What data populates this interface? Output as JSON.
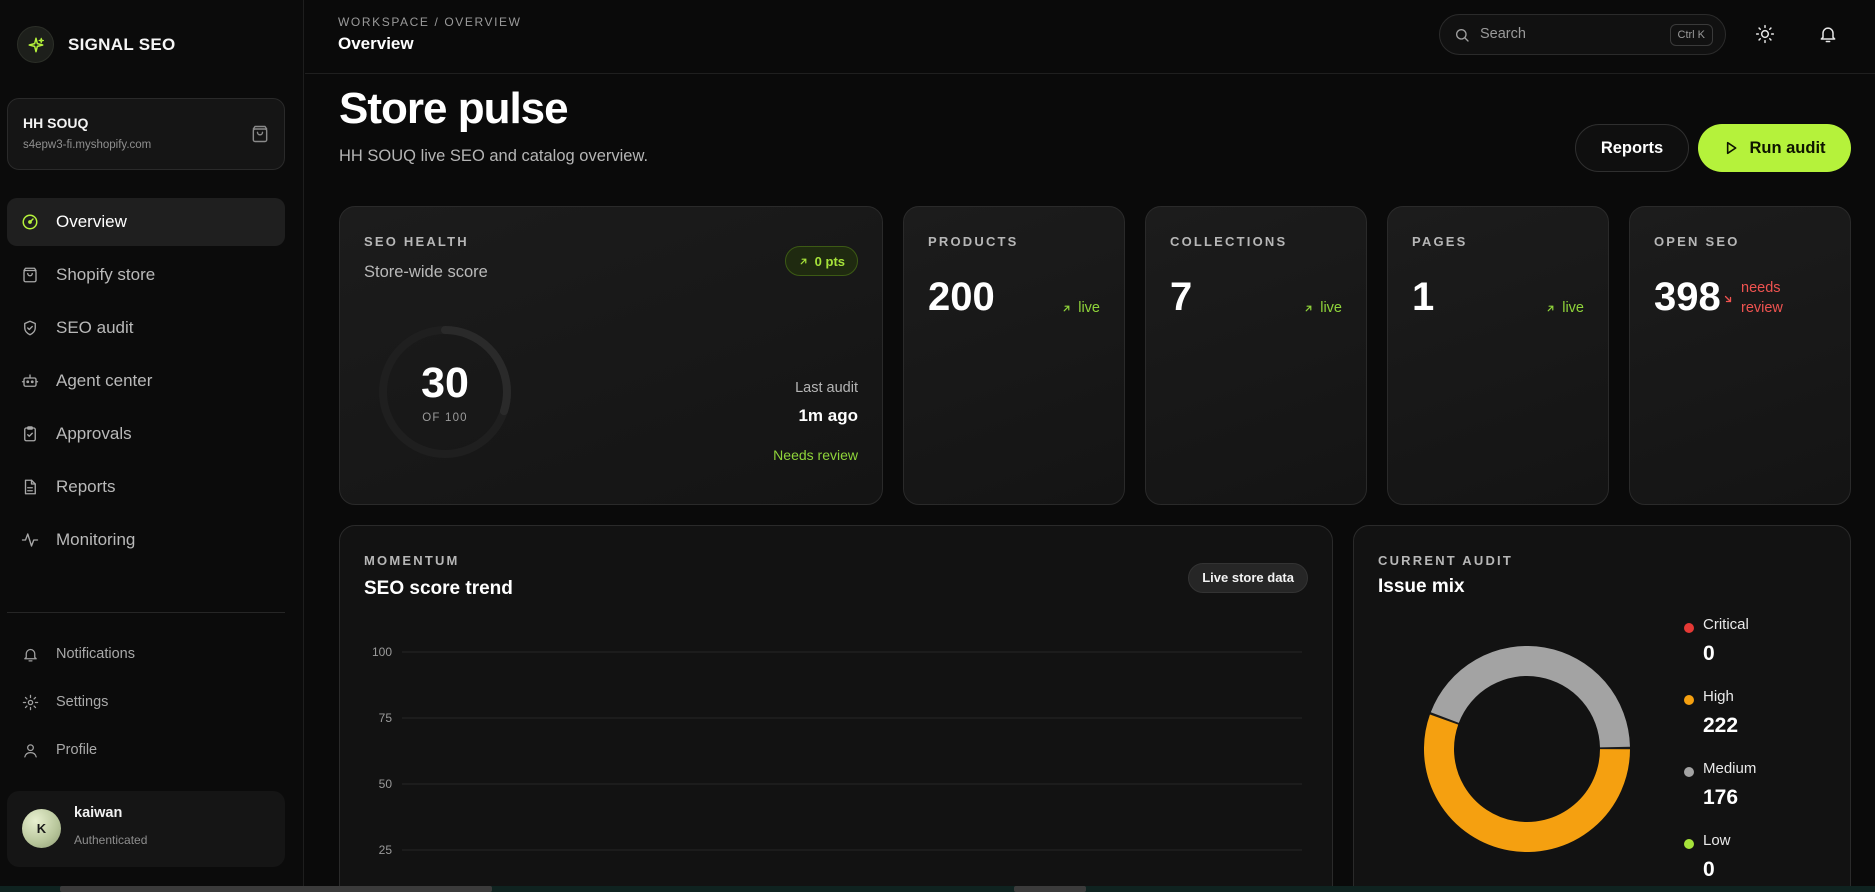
{
  "brand": {
    "name": "SIGNAL SEO"
  },
  "store": {
    "name": "HH SOUQ",
    "domain": "s4epw3-fi.myshopify.com"
  },
  "nav": {
    "items": [
      {
        "label": "Overview",
        "icon": "gauge-icon",
        "active": true
      },
      {
        "label": "Shopify store",
        "icon": "bag-icon",
        "active": false
      },
      {
        "label": "SEO audit",
        "icon": "shield-check-icon",
        "active": false
      },
      {
        "label": "Agent center",
        "icon": "robot-icon",
        "active": false
      },
      {
        "label": "Approvals",
        "icon": "clipboard-check-icon",
        "active": false
      },
      {
        "label": "Reports",
        "icon": "document-icon",
        "active": false
      },
      {
        "label": "Monitoring",
        "icon": "pulse-icon",
        "active": false
      }
    ],
    "secondary": [
      {
        "label": "Notifications",
        "icon": "bell-icon"
      },
      {
        "label": "Settings",
        "icon": "gear-icon"
      },
      {
        "label": "Profile",
        "icon": "user-icon"
      }
    ]
  },
  "user": {
    "initial": "K",
    "name": "kaiwan",
    "status": "Authenticated"
  },
  "topbar": {
    "breadcrumb": "WORKSPACE / OVERVIEW",
    "title": "Overview",
    "search_placeholder": "Search",
    "search_shortcut": "Ctrl K"
  },
  "header": {
    "title": "Store pulse",
    "subtitle": "HH SOUQ live SEO and catalog overview.",
    "reports_label": "Reports",
    "run_audit_label": "Run audit"
  },
  "health": {
    "kicker": "SEO HEALTH",
    "subtitle": "Store-wide score",
    "delta": "0 pts",
    "score": "30",
    "score_of": "OF 100",
    "score_fraction": 0.3,
    "last_audit_label": "Last audit",
    "last_audit_value": "1m ago",
    "status": "Needs review"
  },
  "stats": [
    {
      "kicker": "PRODUCTS",
      "value": "200",
      "trend": "live"
    },
    {
      "kicker": "COLLECTIONS",
      "value": "7",
      "trend": "live"
    },
    {
      "kicker": "PAGES",
      "value": "1",
      "trend": "live"
    },
    {
      "kicker": "OPEN SEO",
      "value": "398",
      "trend": "needs review"
    }
  ],
  "momentum": {
    "kicker": "MOMENTUM",
    "title": "SEO score trend",
    "badge": "Live store data"
  },
  "chart_data": {
    "type": "line",
    "title": "SEO score trend",
    "xlabel": "",
    "ylabel": "",
    "ylim": [
      0,
      100
    ],
    "yticks": [
      "100",
      "75",
      "50",
      "25"
    ],
    "grid": true,
    "series": []
  },
  "issues": {
    "kicker": "CURRENT AUDIT",
    "title": "Issue mix",
    "items": [
      {
        "label": "Critical",
        "value": "0",
        "count": 0,
        "color": "#e53935"
      },
      {
        "label": "High",
        "value": "222",
        "count": 222,
        "color": "#f5a010"
      },
      {
        "label": "Medium",
        "value": "176",
        "count": 176,
        "color": "#a3a3a3"
      },
      {
        "label": "Low",
        "value": "0",
        "count": 0,
        "color": "#a6e23a"
      }
    ]
  },
  "colors": {
    "accent": "#b5f23b",
    "live": "#8fd43a",
    "warning": "#ef5350"
  }
}
